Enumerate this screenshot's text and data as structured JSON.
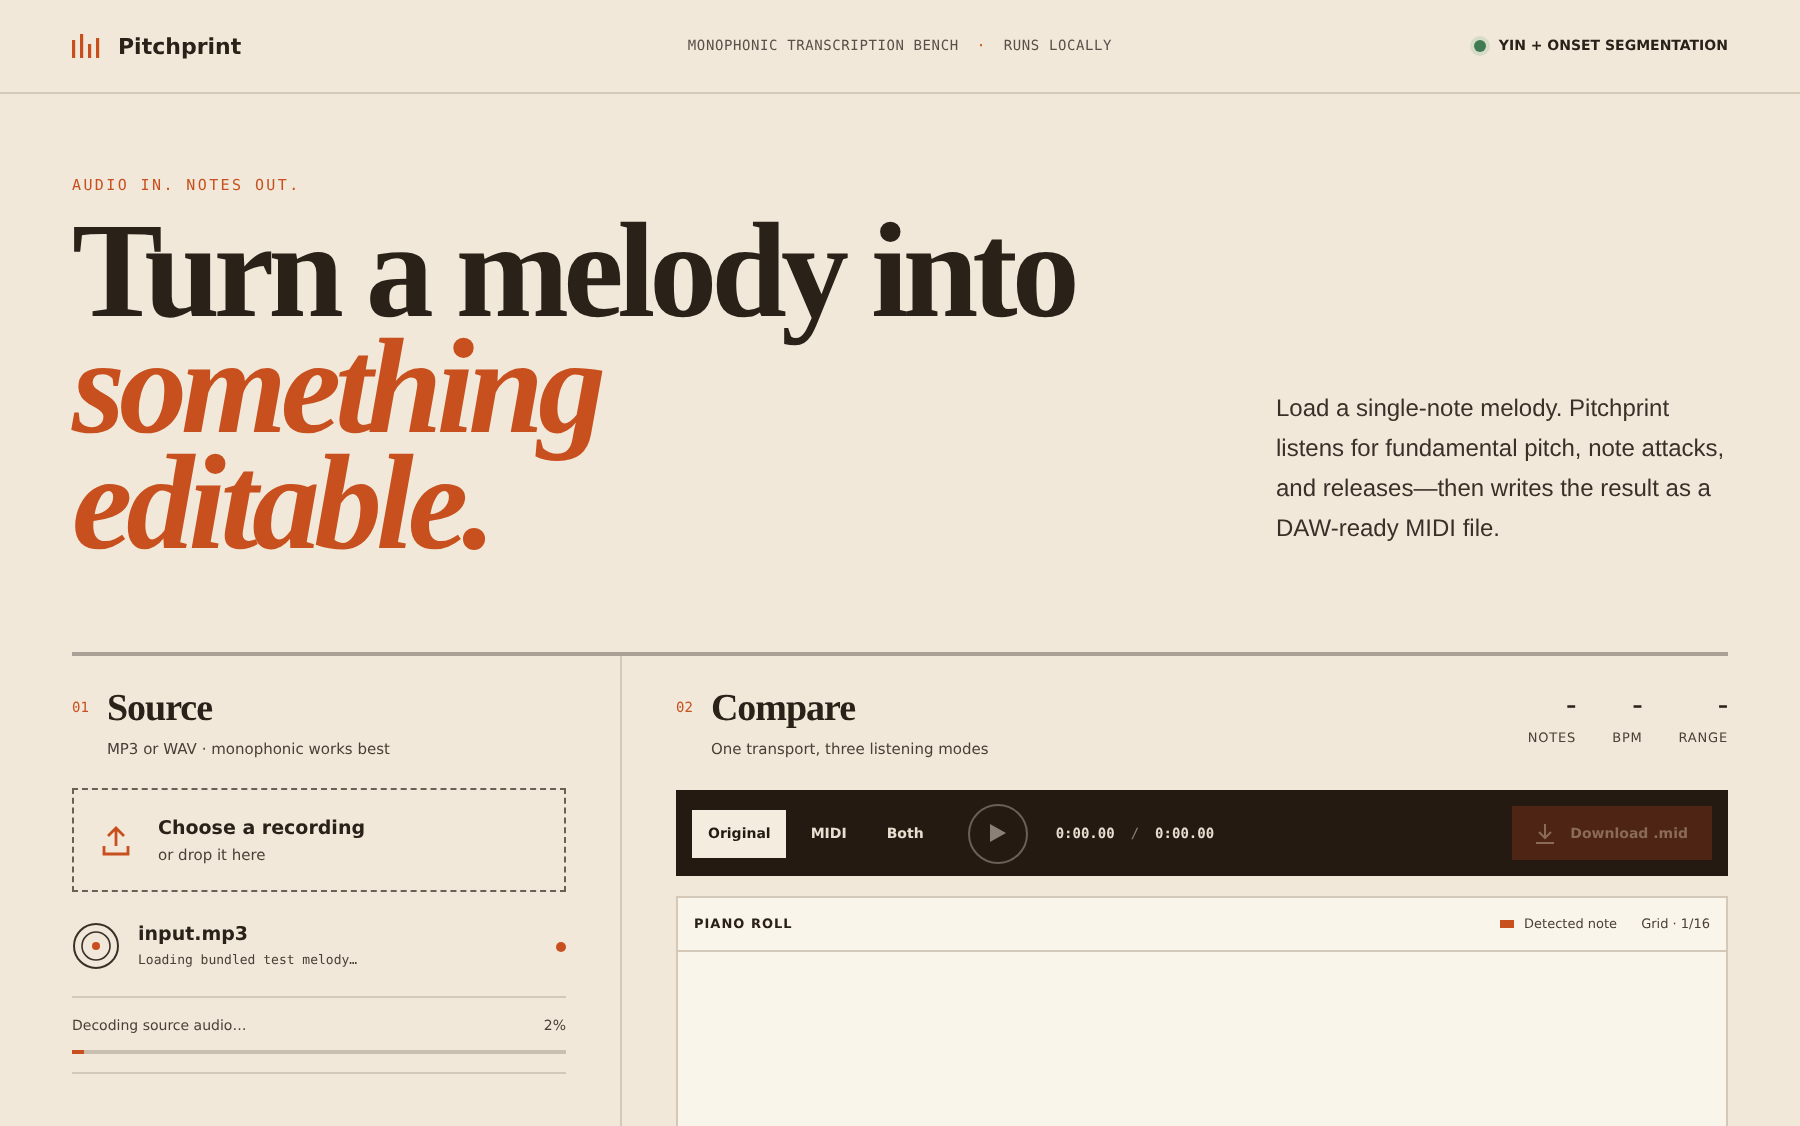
{
  "header": {
    "brand": "Pitchprint",
    "tagline": "MONOPHONIC TRANSCRIPTION BENCH",
    "separator": "·",
    "mode": "RUNS LOCALLY",
    "engine": "YIN + ONSET SEGMENTATION"
  },
  "hero": {
    "eyebrow": "AUDIO IN. NOTES OUT.",
    "title_lines": [
      {
        "text": "Turn a melody into",
        "kind": "plain"
      },
      {
        "text": "something",
        "kind": "accent"
      },
      {
        "text": "editable.",
        "kind": "accent"
      }
    ],
    "description": "Load a single-note melody. Pitchprint listens for fundamental pitch, note attacks, and releases—then writes the result as a DAW-ready MIDI file."
  },
  "source": {
    "number": "01",
    "title": "Source",
    "subtitle": "MP3 or WAV · monophonic works best",
    "dropzone": {
      "title": "Choose a recording",
      "hint": "or drop it here"
    },
    "file": {
      "name": "input.mp3",
      "status": "Loading bundled test melody…",
      "busy": true
    },
    "progress": {
      "label": "Decoding source audio…",
      "reading": "2%",
      "level": 0.02
    }
  },
  "compare": {
    "number": "02",
    "title": "Compare",
    "subtitle": "One transport, three listening modes",
    "stats": [
      {
        "value": "–",
        "label": "NOTES"
      },
      {
        "value": "–",
        "label": "BPM"
      },
      {
        "value": "–",
        "label": "RANGE"
      }
    ],
    "modes": [
      {
        "label": "Original",
        "selected": true
      },
      {
        "label": "MIDI",
        "selected": false
      },
      {
        "label": "Both",
        "selected": false
      }
    ],
    "time": "0:00.00",
    "separator": "/",
    "duration": "0:00.00",
    "download": {
      "label": "Download .mid",
      "disabled": true
    },
    "piano_roll": {
      "title": "PIANO ROLL",
      "legend": "Detected note",
      "grid": "Grid · 1/16"
    }
  }
}
